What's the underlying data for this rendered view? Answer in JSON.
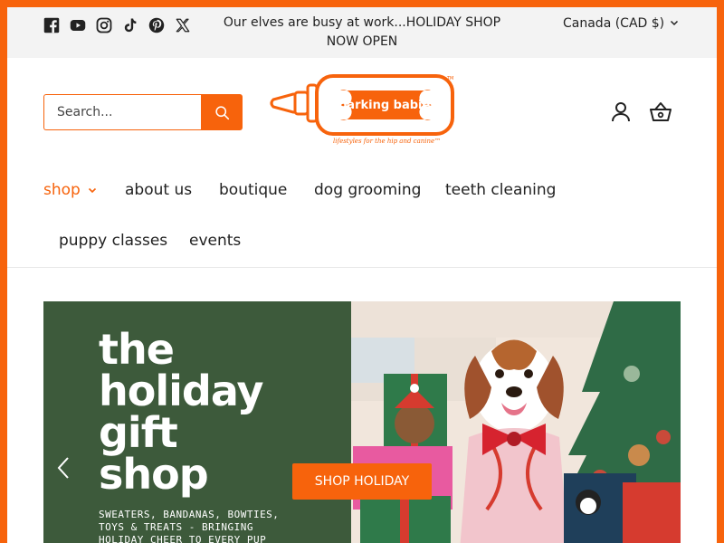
{
  "announcement": {
    "social_icons": [
      "facebook-icon",
      "youtube-icon",
      "instagram-icon",
      "tiktok-icon",
      "pinterest-icon",
      "x-icon"
    ],
    "message": "Our elves are busy at work...HOLIDAY SHOP NOW OPEN",
    "currency": "Canada (CAD $)"
  },
  "header": {
    "search_placeholder": "Search...",
    "logo_name": "barking babies",
    "logo_tagline": "lifestyles for the hip and canine™"
  },
  "nav": {
    "items": [
      {
        "label": "shop",
        "active": true
      },
      {
        "label": "about us"
      },
      {
        "label": "boutique"
      },
      {
        "label": "dog grooming"
      },
      {
        "label": "teeth cleaning"
      },
      {
        "label": "puppy classes"
      },
      {
        "label": "events"
      }
    ]
  },
  "hero": {
    "title_lines": [
      "the",
      "holiday",
      "gift",
      "shop"
    ],
    "subtitle": "SWEATERS, BANDANAS, BOWTIES, TOYS & TREATS - BRINGING HOLIDAY CHEER TO EVERY PUP",
    "cta_label": "SHOP HOLIDAY"
  },
  "colors": {
    "brand_orange": "#f7630c",
    "hero_green": "#3d5a3b"
  }
}
